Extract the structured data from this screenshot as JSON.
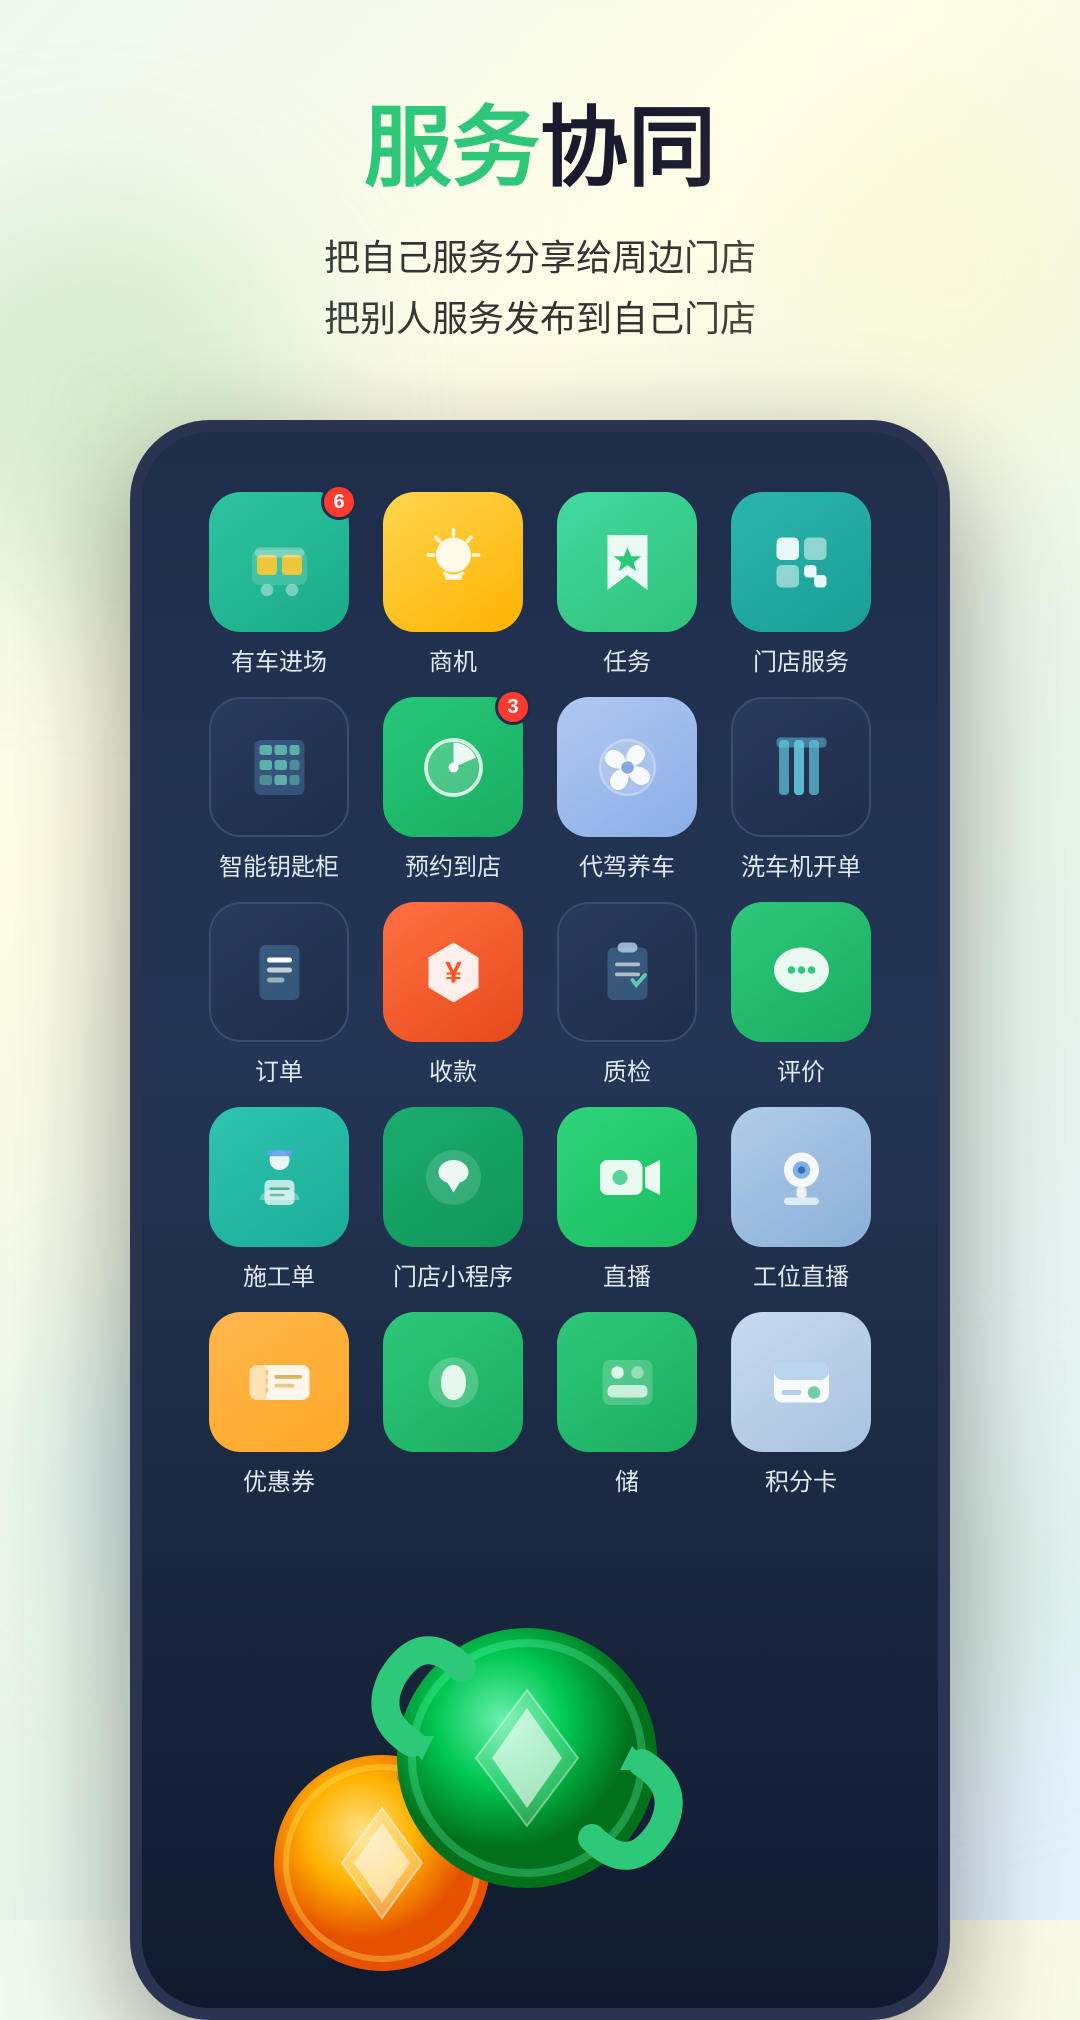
{
  "header": {
    "title_green": "服务",
    "title_dark": "协同",
    "subtitle_line1": "把自己服务分享给周边门店",
    "subtitle_line2": "把别人服务发布到自己门店"
  },
  "apps": [
    {
      "id": "car-entry",
      "label": "有车进场",
      "badge": "6",
      "icon_type": "car",
      "bg": "teal"
    },
    {
      "id": "opportunity",
      "label": "商机",
      "badge": null,
      "icon_type": "bulb",
      "bg": "yellow"
    },
    {
      "id": "task",
      "label": "任务",
      "badge": null,
      "icon_type": "bookmark",
      "bg": "green"
    },
    {
      "id": "store-service",
      "label": "门店服务",
      "badge": null,
      "icon_type": "grid",
      "bg": "teal2"
    },
    {
      "id": "smart-cabinet",
      "label": "智能钥匙柜",
      "badge": null,
      "icon_type": "calculator",
      "bg": "dark"
    },
    {
      "id": "appointment",
      "label": "预约到店",
      "badge": "3",
      "icon_type": "clock",
      "bg": "green2"
    },
    {
      "id": "valet",
      "label": "代驾养车",
      "badge": null,
      "icon_type": "fan",
      "bg": "blue_light"
    },
    {
      "id": "wash-machine",
      "label": "洗车机开单",
      "badge": null,
      "icon_type": "machine",
      "bg": "dark"
    },
    {
      "id": "order",
      "label": "订单",
      "badge": null,
      "icon_type": "list",
      "bg": "dark"
    },
    {
      "id": "payment",
      "label": "收款",
      "badge": null,
      "icon_type": "yuan",
      "bg": "orange"
    },
    {
      "id": "quality",
      "label": "质检",
      "badge": null,
      "icon_type": "clipboard",
      "bg": "dark2"
    },
    {
      "id": "review",
      "label": "评价",
      "badge": null,
      "icon_type": "chat",
      "bg": "green3"
    },
    {
      "id": "work-order",
      "label": "施工单",
      "badge": null,
      "icon_type": "worker",
      "bg": "teal3"
    },
    {
      "id": "mini-program",
      "label": "门店小程序",
      "badge": null,
      "icon_type": "wechat",
      "bg": "green4"
    },
    {
      "id": "live",
      "label": "直播",
      "badge": null,
      "icon_type": "camera",
      "bg": "green5"
    },
    {
      "id": "workstation",
      "label": "工位直播",
      "badge": null,
      "icon_type": "webcam",
      "bg": "light_blue"
    },
    {
      "id": "coupon",
      "label": "优惠券",
      "badge": null,
      "icon_type": "coupon",
      "bg": "orange2"
    },
    {
      "id": "store2",
      "label": "",
      "badge": null,
      "icon_type": "coin_green_small",
      "bg": "green6"
    },
    {
      "id": "storage",
      "label": "储",
      "badge": null,
      "icon_type": "storage_hidden",
      "bg": ""
    },
    {
      "id": "points",
      "label": "积分卡",
      "badge": null,
      "icon_type": "card",
      "bg": "light_gray"
    }
  ]
}
